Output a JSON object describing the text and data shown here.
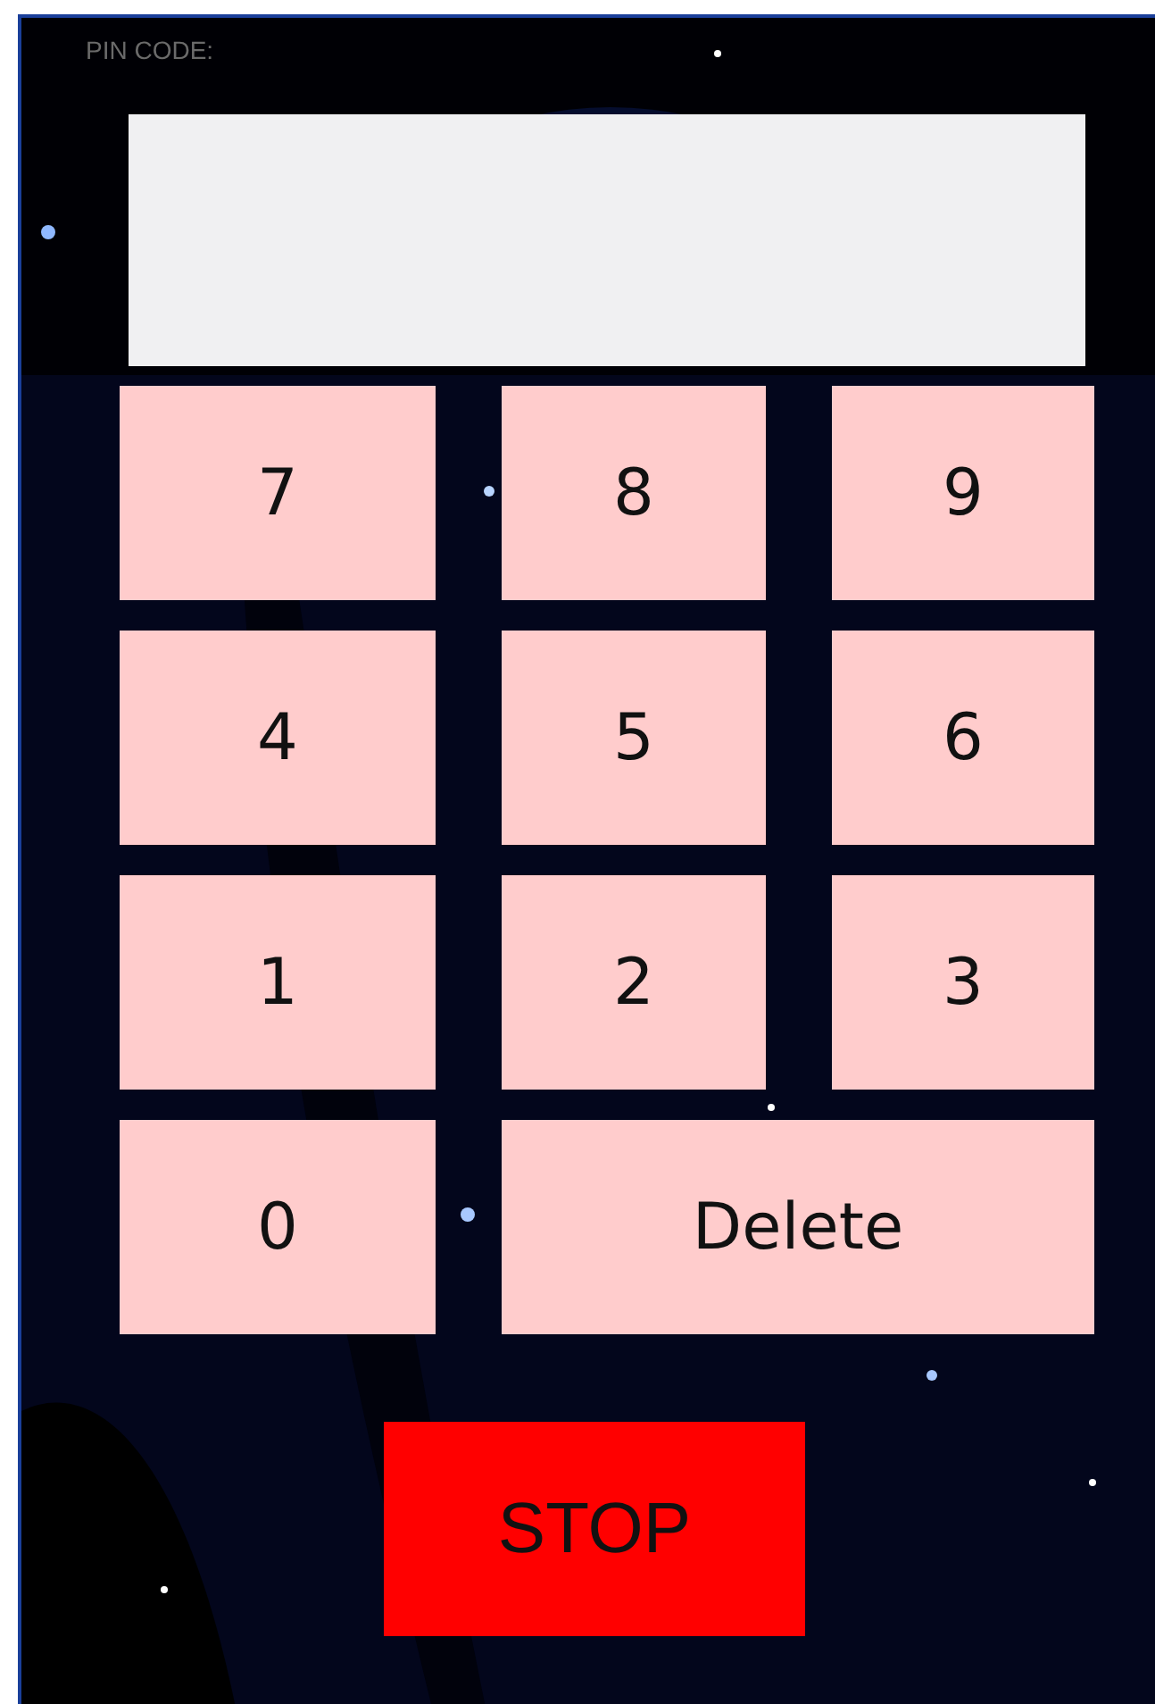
{
  "label": "PIN CODE:",
  "keys": [
    {
      "label": "7",
      "kind": "digit"
    },
    {
      "label": "8",
      "kind": "digit"
    },
    {
      "label": "9",
      "kind": "digit"
    },
    {
      "label": "4",
      "kind": "digit"
    },
    {
      "label": "5",
      "kind": "digit"
    },
    {
      "label": "6",
      "kind": "digit"
    },
    {
      "label": "1",
      "kind": "digit"
    },
    {
      "label": "2",
      "kind": "digit"
    },
    {
      "label": "3",
      "kind": "digit"
    },
    {
      "label": "0",
      "kind": "digit"
    },
    {
      "label": "Delete",
      "kind": "wide"
    }
  ],
  "stop_button": {
    "label": "STOP"
  }
}
